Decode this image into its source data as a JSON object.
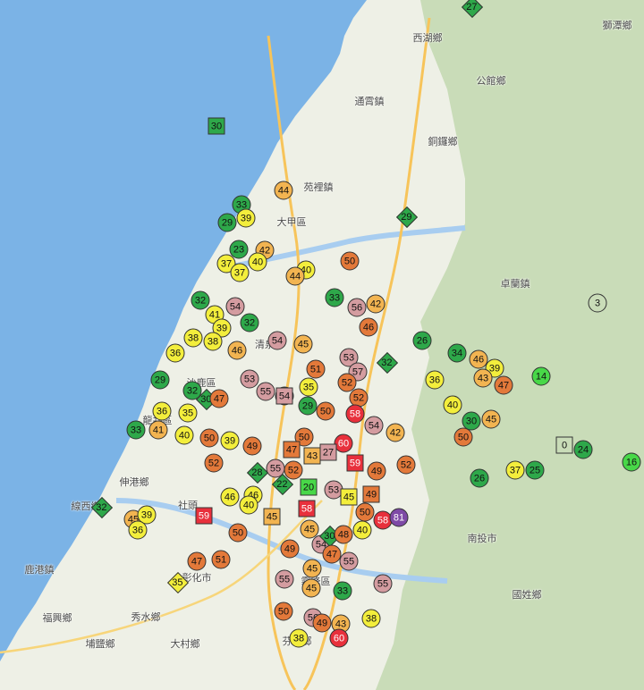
{
  "colors": {
    "green": "#2ea84a",
    "brightgreen": "#48d848",
    "yellow": "#f3ee3c",
    "lightorange": "#f2b451",
    "orange": "#e3793a",
    "pink": "#d49ca0",
    "red": "#e8303c",
    "purple": "#7e4aa6",
    "sea": "#7bb3e6",
    "land": "#eef0e6",
    "mountain": "#c9dcb8"
  },
  "place_labels": [
    "西湖鄉",
    "獅潭鄉",
    "公館鄉",
    "通霄鎮",
    "銅鑼鄉",
    "苑裡鎮",
    "大甲區",
    "卓蘭鎮",
    "清泉",
    "沙鹿區",
    "龍井區",
    "伸港鄉",
    "線西鄉",
    "鹿港鎮",
    "福興鄉",
    "秀水鄉",
    "彰化市",
    "芬園鄉",
    "國姓鄉",
    "埔鹽鄉",
    "大村鄉",
    "霧峰區",
    "社頭",
    "南投市"
  ],
  "markers": [
    {
      "v": "27",
      "shape": "diamond",
      "color": "green"
    },
    {
      "v": "30",
      "shape": "square",
      "color": "green"
    },
    {
      "v": "44",
      "shape": "circle",
      "color": "lightorange"
    },
    {
      "v": "33",
      "shape": "circle",
      "color": "green"
    },
    {
      "v": "29",
      "shape": "circle",
      "color": "green"
    },
    {
      "v": "39",
      "shape": "circle",
      "color": "yellow"
    },
    {
      "v": "29",
      "shape": "diamond",
      "color": "green"
    },
    {
      "v": "23",
      "shape": "circle",
      "color": "green"
    },
    {
      "v": "42",
      "shape": "circle",
      "color": "lightorange"
    },
    {
      "v": "37",
      "shape": "circle",
      "color": "yellow"
    },
    {
      "v": "40",
      "shape": "circle",
      "color": "yellow"
    },
    {
      "v": "37",
      "shape": "circle",
      "color": "yellow"
    },
    {
      "v": "40",
      "shape": "circle",
      "color": "yellow"
    },
    {
      "v": "44",
      "shape": "circle",
      "color": "lightorange"
    },
    {
      "v": "50",
      "shape": "circle",
      "color": "orange"
    },
    {
      "v": "3",
      "shape": "circle",
      "color": "mountain"
    },
    {
      "v": "33",
      "shape": "circle",
      "color": "green"
    },
    {
      "v": "32",
      "shape": "circle",
      "color": "green"
    },
    {
      "v": "56",
      "shape": "circle",
      "color": "pink"
    },
    {
      "v": "42",
      "shape": "circle",
      "color": "lightorange"
    },
    {
      "v": "54",
      "shape": "circle",
      "color": "pink"
    },
    {
      "v": "41",
      "shape": "circle",
      "color": "yellow"
    },
    {
      "v": "32",
      "shape": "circle",
      "color": "green"
    },
    {
      "v": "39",
      "shape": "circle",
      "color": "yellow"
    },
    {
      "v": "38",
      "shape": "circle",
      "color": "yellow"
    },
    {
      "v": "38",
      "shape": "circle",
      "color": "yellow"
    },
    {
      "v": "46",
      "shape": "circle",
      "color": "lightorange"
    },
    {
      "v": "54",
      "shape": "circle",
      "color": "pink"
    },
    {
      "v": "45",
      "shape": "circle",
      "color": "lightorange"
    },
    {
      "v": "46",
      "shape": "circle",
      "color": "orange"
    },
    {
      "v": "26",
      "shape": "circle",
      "color": "green"
    },
    {
      "v": "34",
      "shape": "circle",
      "color": "green"
    },
    {
      "v": "46",
      "shape": "circle",
      "color": "lightorange"
    },
    {
      "v": "39",
      "shape": "circle",
      "color": "yellow"
    },
    {
      "v": "36",
      "shape": "circle",
      "color": "yellow"
    },
    {
      "v": "53",
      "shape": "circle",
      "color": "pink"
    },
    {
      "v": "51",
      "shape": "circle",
      "color": "orange"
    },
    {
      "v": "57",
      "shape": "circle",
      "color": "pink"
    },
    {
      "v": "32",
      "shape": "diamond",
      "color": "green"
    },
    {
      "v": "53",
      "shape": "circle",
      "color": "pink"
    },
    {
      "v": "55",
      "shape": "circle",
      "color": "pink"
    },
    {
      "v": "52",
      "shape": "circle",
      "color": "orange"
    },
    {
      "v": "29",
      "shape": "circle",
      "color": "green"
    },
    {
      "v": "32",
      "shape": "circle",
      "color": "green"
    },
    {
      "v": "30",
      "shape": "diamond",
      "color": "green"
    },
    {
      "v": "47",
      "shape": "circle",
      "color": "orange"
    },
    {
      "v": "36",
      "shape": "circle",
      "color": "yellow"
    },
    {
      "v": "43",
      "shape": "circle",
      "color": "lightorange"
    },
    {
      "v": "47",
      "shape": "circle",
      "color": "orange"
    },
    {
      "v": "14",
      "shape": "circle",
      "color": "brightgreen"
    },
    {
      "v": "55",
      "shape": "circle",
      "color": "pink"
    },
    {
      "v": "54",
      "shape": "square",
      "color": "pink"
    },
    {
      "v": "35",
      "shape": "circle",
      "color": "yellow"
    },
    {
      "v": "52",
      "shape": "circle",
      "color": "orange"
    },
    {
      "v": "36",
      "shape": "circle",
      "color": "yellow"
    },
    {
      "v": "35",
      "shape": "circle",
      "color": "yellow"
    },
    {
      "v": "29",
      "shape": "circle",
      "color": "green"
    },
    {
      "v": "50",
      "shape": "circle",
      "color": "orange"
    },
    {
      "v": "58",
      "shape": "circle",
      "color": "red"
    },
    {
      "v": "40",
      "shape": "circle",
      "color": "yellow"
    },
    {
      "v": "30",
      "shape": "circle",
      "color": "green"
    },
    {
      "v": "45",
      "shape": "circle",
      "color": "lightorange"
    },
    {
      "v": "33",
      "shape": "circle",
      "color": "green"
    },
    {
      "v": "41",
      "shape": "circle",
      "color": "lightorange"
    },
    {
      "v": "40",
      "shape": "circle",
      "color": "yellow"
    },
    {
      "v": "50",
      "shape": "circle",
      "color": "orange"
    },
    {
      "v": "39",
      "shape": "circle",
      "color": "yellow"
    },
    {
      "v": "49",
      "shape": "circle",
      "color": "orange"
    },
    {
      "v": "50",
      "shape": "circle",
      "color": "orange"
    },
    {
      "v": "60",
      "shape": "circle",
      "color": "red"
    },
    {
      "v": "54",
      "shape": "circle",
      "color": "pink"
    },
    {
      "v": "42",
      "shape": "circle",
      "color": "lightorange"
    },
    {
      "v": "50",
      "shape": "circle",
      "color": "orange"
    },
    {
      "v": "0",
      "shape": "square",
      "color": "mountain"
    },
    {
      "v": "24",
      "shape": "circle",
      "color": "green"
    },
    {
      "v": "16",
      "shape": "circle",
      "color": "brightgreen"
    },
    {
      "v": "52",
      "shape": "circle",
      "color": "orange"
    },
    {
      "v": "47",
      "shape": "square",
      "color": "orange"
    },
    {
      "v": "43",
      "shape": "square",
      "color": "lightorange"
    },
    {
      "v": "27",
      "shape": "square",
      "color": "pink"
    },
    {
      "v": "59",
      "shape": "square",
      "color": "red"
    },
    {
      "v": "55",
      "shape": "circle",
      "color": "pink"
    },
    {
      "v": "52",
      "shape": "circle",
      "color": "orange"
    },
    {
      "v": "49",
      "shape": "circle",
      "color": "orange"
    },
    {
      "v": "28",
      "shape": "diamond",
      "color": "green"
    },
    {
      "v": "52",
      "shape": "circle",
      "color": "orange"
    },
    {
      "v": "26",
      "shape": "circle",
      "color": "green"
    },
    {
      "v": "37",
      "shape": "circle",
      "color": "yellow"
    },
    {
      "v": "25",
      "shape": "circle",
      "color": "green"
    },
    {
      "v": "22",
      "shape": "diamond",
      "color": "green"
    },
    {
      "v": "20",
      "shape": "square",
      "color": "brightgreen"
    },
    {
      "v": "53",
      "shape": "circle",
      "color": "pink"
    },
    {
      "v": "49",
      "shape": "square",
      "color": "orange"
    },
    {
      "v": "45",
      "shape": "square",
      "color": "yellow"
    },
    {
      "v": "46",
      "shape": "circle",
      "color": "yellow"
    },
    {
      "v": "40",
      "shape": "circle",
      "color": "yellow"
    },
    {
      "v": "46",
      "shape": "circle",
      "color": "yellow"
    },
    {
      "v": "32",
      "shape": "diamond",
      "color": "green"
    },
    {
      "v": "45",
      "shape": "circle",
      "color": "lightorange"
    },
    {
      "v": "39",
      "shape": "circle",
      "color": "yellow"
    },
    {
      "v": "36",
      "shape": "circle",
      "color": "yellow"
    },
    {
      "v": "59",
      "shape": "square",
      "color": "red"
    },
    {
      "v": "45",
      "shape": "square",
      "color": "lightorange"
    },
    {
      "v": "58",
      "shape": "square",
      "color": "red"
    },
    {
      "v": "50",
      "shape": "circle",
      "color": "orange"
    },
    {
      "v": "58",
      "shape": "circle",
      "color": "red"
    },
    {
      "v": "81",
      "shape": "circle",
      "color": "purple"
    },
    {
      "v": "50",
      "shape": "circle",
      "color": "orange"
    },
    {
      "v": "45",
      "shape": "circle",
      "color": "lightorange"
    },
    {
      "v": "40",
      "shape": "circle",
      "color": "yellow"
    },
    {
      "v": "54",
      "shape": "circle",
      "color": "pink"
    },
    {
      "v": "30",
      "shape": "diamond",
      "color": "green"
    },
    {
      "v": "48",
      "shape": "circle",
      "color": "orange"
    },
    {
      "v": "49",
      "shape": "circle",
      "color": "orange"
    },
    {
      "v": "47",
      "shape": "circle",
      "color": "orange"
    },
    {
      "v": "51",
      "shape": "circle",
      "color": "orange"
    },
    {
      "v": "47",
      "shape": "circle",
      "color": "orange"
    },
    {
      "v": "45",
      "shape": "circle",
      "color": "lightorange"
    },
    {
      "v": "55",
      "shape": "circle",
      "color": "pink"
    },
    {
      "v": "35",
      "shape": "diamond",
      "color": "yellow"
    },
    {
      "v": "55",
      "shape": "circle",
      "color": "pink"
    },
    {
      "v": "45",
      "shape": "circle",
      "color": "lightorange"
    },
    {
      "v": "33",
      "shape": "circle",
      "color": "green"
    },
    {
      "v": "55",
      "shape": "circle",
      "color": "pink"
    },
    {
      "v": "38",
      "shape": "circle",
      "color": "yellow"
    },
    {
      "v": "50",
      "shape": "circle",
      "color": "orange"
    },
    {
      "v": "56",
      "shape": "circle",
      "color": "pink"
    },
    {
      "v": "49",
      "shape": "circle",
      "color": "orange"
    },
    {
      "v": "43",
      "shape": "circle",
      "color": "lightorange"
    },
    {
      "v": "38",
      "shape": "circle",
      "color": "yellow"
    },
    {
      "v": "60",
      "shape": "circle",
      "color": "red"
    },
    {
      "v": "51",
      "shape": "circle",
      "color": "orange"
    }
  ]
}
